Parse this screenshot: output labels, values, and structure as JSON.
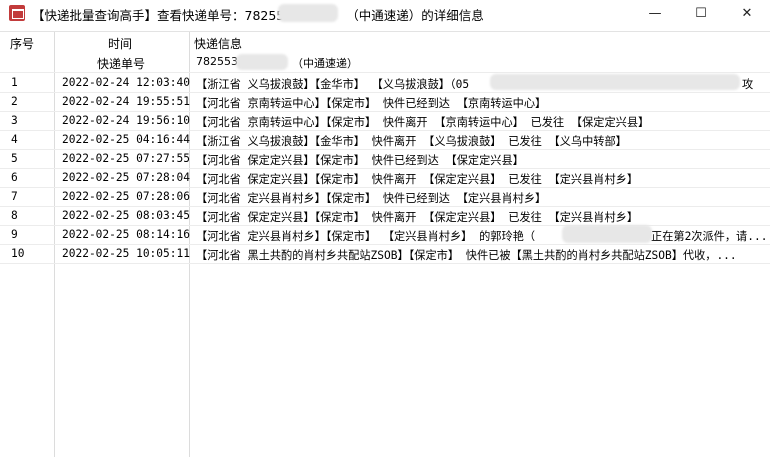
{
  "window": {
    "title": "【快递批量查询高手】查看快递单号：78255",
    "title_suffix": "（中通速递）的详细信息",
    "buttons": {
      "minimize": "—",
      "maximize": "☐",
      "close": "✕"
    }
  },
  "table": {
    "headers": {
      "index": "序号",
      "time": "时间",
      "info": "快递信息"
    },
    "subheader": {
      "label": "快递单号",
      "number": "782553",
      "courier": "（中通速递）"
    },
    "rows": [
      {
        "idx": "1",
        "time": "2022-02-24 12:03:40",
        "info": "【浙江省 义乌拔浪鼓】【金华市】 【义乌拔浪鼓】（05",
        "tail": "攻"
      },
      {
        "idx": "2",
        "time": "2022-02-24 19:55:51",
        "info": "【河北省 京南转运中心】【保定市】 快件已经到达 【京南转运中心】"
      },
      {
        "idx": "3",
        "time": "2022-02-24 19:56:10",
        "info": "【河北省 京南转运中心】【保定市】 快件离开 【京南转运中心】 已发往 【保定定兴县】"
      },
      {
        "idx": "4",
        "time": "2022-02-25 04:16:44",
        "info": "【浙江省 义乌拔浪鼓】【金华市】 快件离开 【义乌拔浪鼓】 已发往 【义乌中转部】"
      },
      {
        "idx": "5",
        "time": "2022-02-25 07:27:55",
        "info": "【河北省 保定定兴县】【保定市】 快件已经到达 【保定定兴县】"
      },
      {
        "idx": "6",
        "time": "2022-02-25 07:28:04",
        "info": "【河北省 保定定兴县】【保定市】 快件离开 【保定定兴县】 已发往 【定兴县肖村乡】"
      },
      {
        "idx": "7",
        "time": "2022-02-25 07:28:06",
        "info": "【河北省 定兴县肖村乡】【保定市】 快件已经到达 【定兴县肖村乡】"
      },
      {
        "idx": "8",
        "time": "2022-02-25 08:03:45",
        "info": "【河北省 保定定兴县】【保定市】 快件离开 【保定定兴县】 已发往 【定兴县肖村乡】"
      },
      {
        "idx": "9",
        "time": "2022-02-25 08:14:16",
        "info": "【河北省 定兴县肖村乡】【保定市】 【定兴县肖村乡】 的郭玲艳（",
        "tail": "正在第2次派件，请..."
      },
      {
        "idx": "10",
        "time": "2022-02-25 10:05:11",
        "info": "【河北省 黑土共酌的肖村乡共配站ZSOB】【保定市】 快件已被【黑土共酌的肖村乡共配站ZSOB】代收，..."
      }
    ]
  }
}
